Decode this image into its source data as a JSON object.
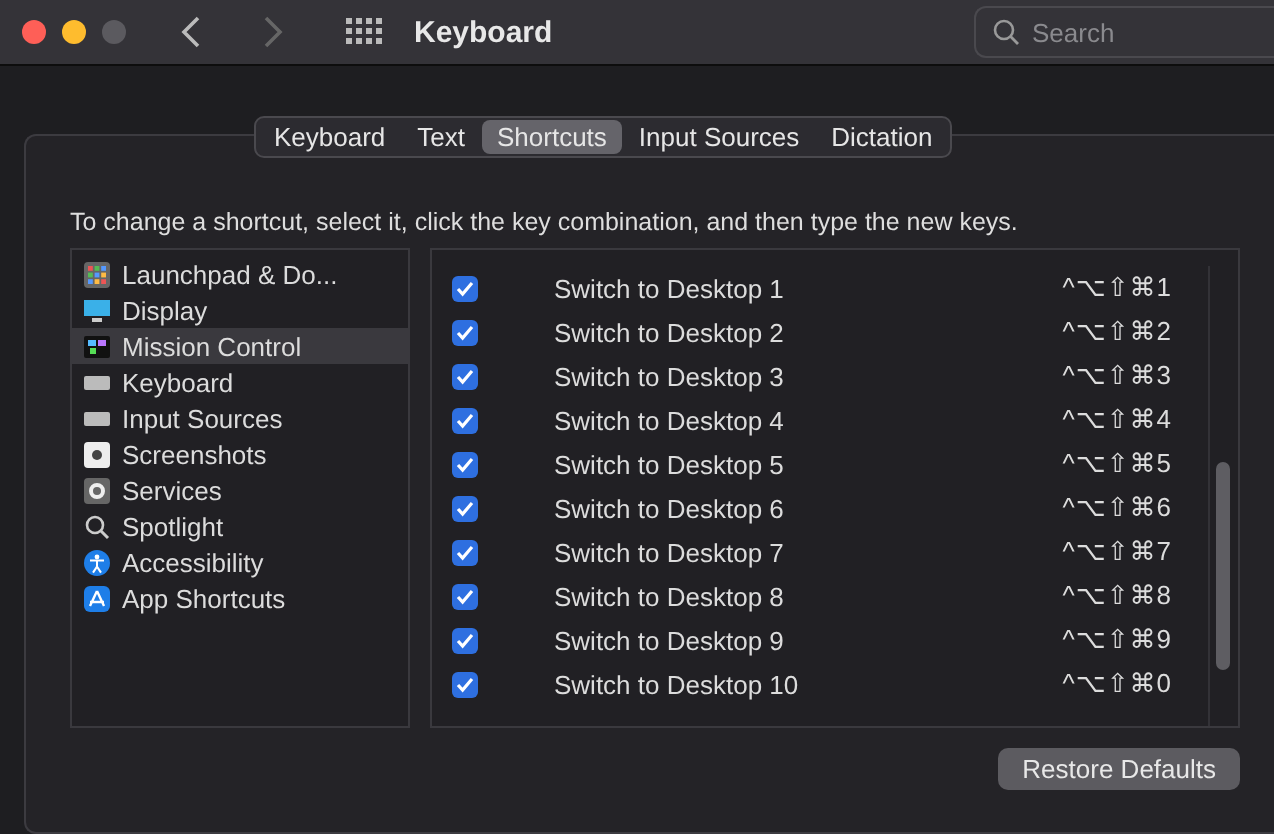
{
  "window": {
    "title": "Keyboard",
    "search_placeholder": "Search"
  },
  "tabs": [
    {
      "label": "Keyboard",
      "selected": false
    },
    {
      "label": "Text",
      "selected": false
    },
    {
      "label": "Shortcuts",
      "selected": true
    },
    {
      "label": "Input Sources",
      "selected": false
    },
    {
      "label": "Dictation",
      "selected": false
    }
  ],
  "instruction": "To change a shortcut, select it, click the key combination, and then type the new keys.",
  "categories": [
    {
      "label": "Launchpad & Do...",
      "kind": "grid",
      "selected": false
    },
    {
      "label": "Display",
      "kind": "display",
      "selected": false
    },
    {
      "label": "Mission Control",
      "kind": "mission",
      "selected": true
    },
    {
      "label": "Keyboard",
      "kind": "keyboard",
      "selected": false
    },
    {
      "label": "Input Sources",
      "kind": "keyboard",
      "selected": false
    },
    {
      "label": "Screenshots",
      "kind": "screenshot",
      "selected": false
    },
    {
      "label": "Services",
      "kind": "gear",
      "selected": false
    },
    {
      "label": "Spotlight",
      "kind": "search",
      "selected": false
    },
    {
      "label": "Accessibility",
      "kind": "accessibility",
      "selected": false
    },
    {
      "label": "App Shortcuts",
      "kind": "appstore",
      "selected": false
    }
  ],
  "shortcuts": [
    {
      "label": "Switch to Desktop 1",
      "keys": "^⌥⇧⌘1",
      "checked": true
    },
    {
      "label": "Switch to Desktop 2",
      "keys": "^⌥⇧⌘2",
      "checked": true
    },
    {
      "label": "Switch to Desktop 3",
      "keys": "^⌥⇧⌘3",
      "checked": true
    },
    {
      "label": "Switch to Desktop 4",
      "keys": "^⌥⇧⌘4",
      "checked": true
    },
    {
      "label": "Switch to Desktop 5",
      "keys": "^⌥⇧⌘5",
      "checked": true
    },
    {
      "label": "Switch to Desktop 6",
      "keys": "^⌥⇧⌘6",
      "checked": true
    },
    {
      "label": "Switch to Desktop 7",
      "keys": "^⌥⇧⌘7",
      "checked": true
    },
    {
      "label": "Switch to Desktop 8",
      "keys": "^⌥⇧⌘8",
      "checked": true
    },
    {
      "label": "Switch to Desktop 9",
      "keys": "^⌥⇧⌘9",
      "checked": true
    },
    {
      "label": "Switch to Desktop 10",
      "keys": "^⌥⇧⌘0",
      "checked": true
    }
  ],
  "restore_button": "Restore Defaults"
}
